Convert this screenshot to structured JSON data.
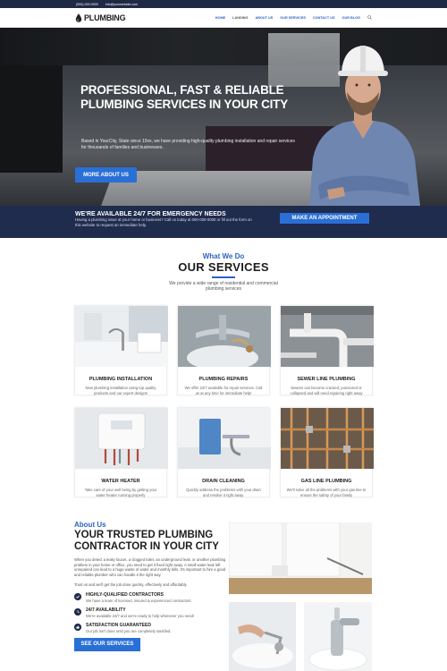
{
  "topbar": {
    "phone": "(000)-000-0000",
    "email": "info@yourwebsite.com"
  },
  "header": {
    "logo_text": "PLUMBING",
    "nav": [
      "HOME",
      "LANDING",
      "ABOUT US",
      "OUR SERVICES",
      "CONTACT US",
      "OUR BLOG"
    ]
  },
  "hero": {
    "title": "PROFESSIONAL, FAST & RELIABLE PLUMBING SERVICES IN YOUR CITY",
    "text": "Based in YourCity, State since 19xx, we have providing high-quality plumbing installation and repair services for thousands of families and businesses.",
    "button": "MORE ABOUT US"
  },
  "emergency": {
    "title": "WE'RE AVAILABLE 24/7 FOR EMERGENCY NEEDS",
    "text": "Having a plumbing issue at your home or business? Call us today at 000-000-0000 or fill out the form on this website to request an immediate help.",
    "button": "MAKE AN APPOINTMENT"
  },
  "services": {
    "eyebrow": "What We Do",
    "title": "OUR SERVICES",
    "subtitle_1": "We provide a wide range of residential and commercial",
    "subtitle_2": "plumbing services",
    "items": [
      {
        "title": "PLUMBING INSTALLATION",
        "text": "New plumbing installation using top quality products and our expert designs"
      },
      {
        "title": "PLUMBING REPAIRS",
        "text": "We offer 24/7 available for repair services. Call us at any time for immediate help!"
      },
      {
        "title": "SEWER LINE PLUMBING",
        "text": "Sewers can become cracked, punctured or collapsed and will need repairing right away"
      },
      {
        "title": "WATER HEATER",
        "text": "Take care of your well being by getting your water heater running properly"
      },
      {
        "title": "DRAIN CLEANING",
        "text": "Quickly address the problems with your drain and resolve it right away."
      },
      {
        "title": "GAS LINE PLUMBING",
        "text": "We'll solve all the problems with your gas line to ensure the safety of your family"
      }
    ]
  },
  "about": {
    "eyebrow": "About Us",
    "title": "YOUR TRUSTED PLUMBING CONTRACTOR IN YOUR CITY",
    "p1": "When you detect a leaky faucet, a clogged toilet, an underground leak, or another plumbing problem in your home or office, you need to get it fixed right away. A small water leak left unrepaired can lead to a huge waste of water and monthly bills. It's important to hire a good and reliable plumber who can handle it the right way.",
    "p2": "Trust us and we'll get the job done quickly, effectively and affordably.",
    "features": [
      {
        "title": "HIGHLY-QUALIFIED CONTRACTORS",
        "text": "We have a team of licensed, insured & experienced contractors."
      },
      {
        "title": "24/7 AVAILABILITY",
        "text": "We're available 24/7 and we're ready to help whenever you need!"
      },
      {
        "title": "SATISFACTION GUARANTEED",
        "text": "Our job isn't done until you are completely satisfied."
      }
    ],
    "button": "SEE OUR SERVICES"
  },
  "colors": {
    "accent": "#2a6fd6",
    "navy": "#1f2c4d"
  }
}
